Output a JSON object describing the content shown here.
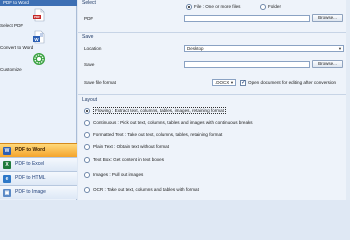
{
  "sidebar": {
    "title": "PDF to Word",
    "tools": [
      {
        "label": "Select PDF",
        "icon": "pdf-file-icon"
      },
      {
        "label": "Convert to Word",
        "icon": "convert-word-icon"
      },
      {
        "label": "Customize",
        "icon": "gear-icon"
      }
    ],
    "nav": [
      {
        "label": "PDF to Word",
        "icon": "word-icon",
        "glyph": "W",
        "color": "#2b5fb4",
        "active": true
      },
      {
        "label": "PDF to Excel",
        "icon": "excel-icon",
        "glyph": "X",
        "color": "#1e7a3c",
        "active": false
      },
      {
        "label": "PDF to HTML",
        "icon": "html-icon",
        "glyph": "e",
        "color": "#2d78c8",
        "active": false
      },
      {
        "label": "PDF to Image",
        "icon": "image-icon",
        "glyph": "▣",
        "color": "#5b8ac6",
        "active": false
      }
    ]
  },
  "select": {
    "title": "Select",
    "option_file": "File : One or more files",
    "option_folder": "Folder",
    "pdf_label": "PDF",
    "pdf_value": "",
    "browse": "Browse..."
  },
  "save": {
    "title": "Save",
    "location_label": "Location",
    "location_value": "Desktop",
    "save_label": "Save",
    "save_value": "",
    "browse": "Browse...",
    "format_label": "Save file format",
    "format_value": ".DOCX",
    "open_doc_label": "Open document for editing after conversion"
  },
  "layout": {
    "title": "Layout",
    "options": [
      {
        "label": "Flowing : Extract text, columns, tables, images, retaining format",
        "selected": true
      },
      {
        "label": "Continuous : Pick out text, columns, tables and images with continuous breaks",
        "selected": false
      },
      {
        "label": "Formatted Text : Take out text, columns, tables, retaining format",
        "selected": false
      },
      {
        "label": "Plain Text : Obtain text without format",
        "selected": false
      },
      {
        "label": "Text Box: Get content in text boxes",
        "selected": false
      },
      {
        "label": "Images : Pull out images",
        "selected": false
      },
      {
        "label": "OCR : Take out text, columns and tables with format",
        "selected": false
      }
    ]
  },
  "colors": {
    "accent": "#3c6fb4",
    "active_nav": "#f4a42c",
    "panel_bg": "#eef3fa"
  }
}
